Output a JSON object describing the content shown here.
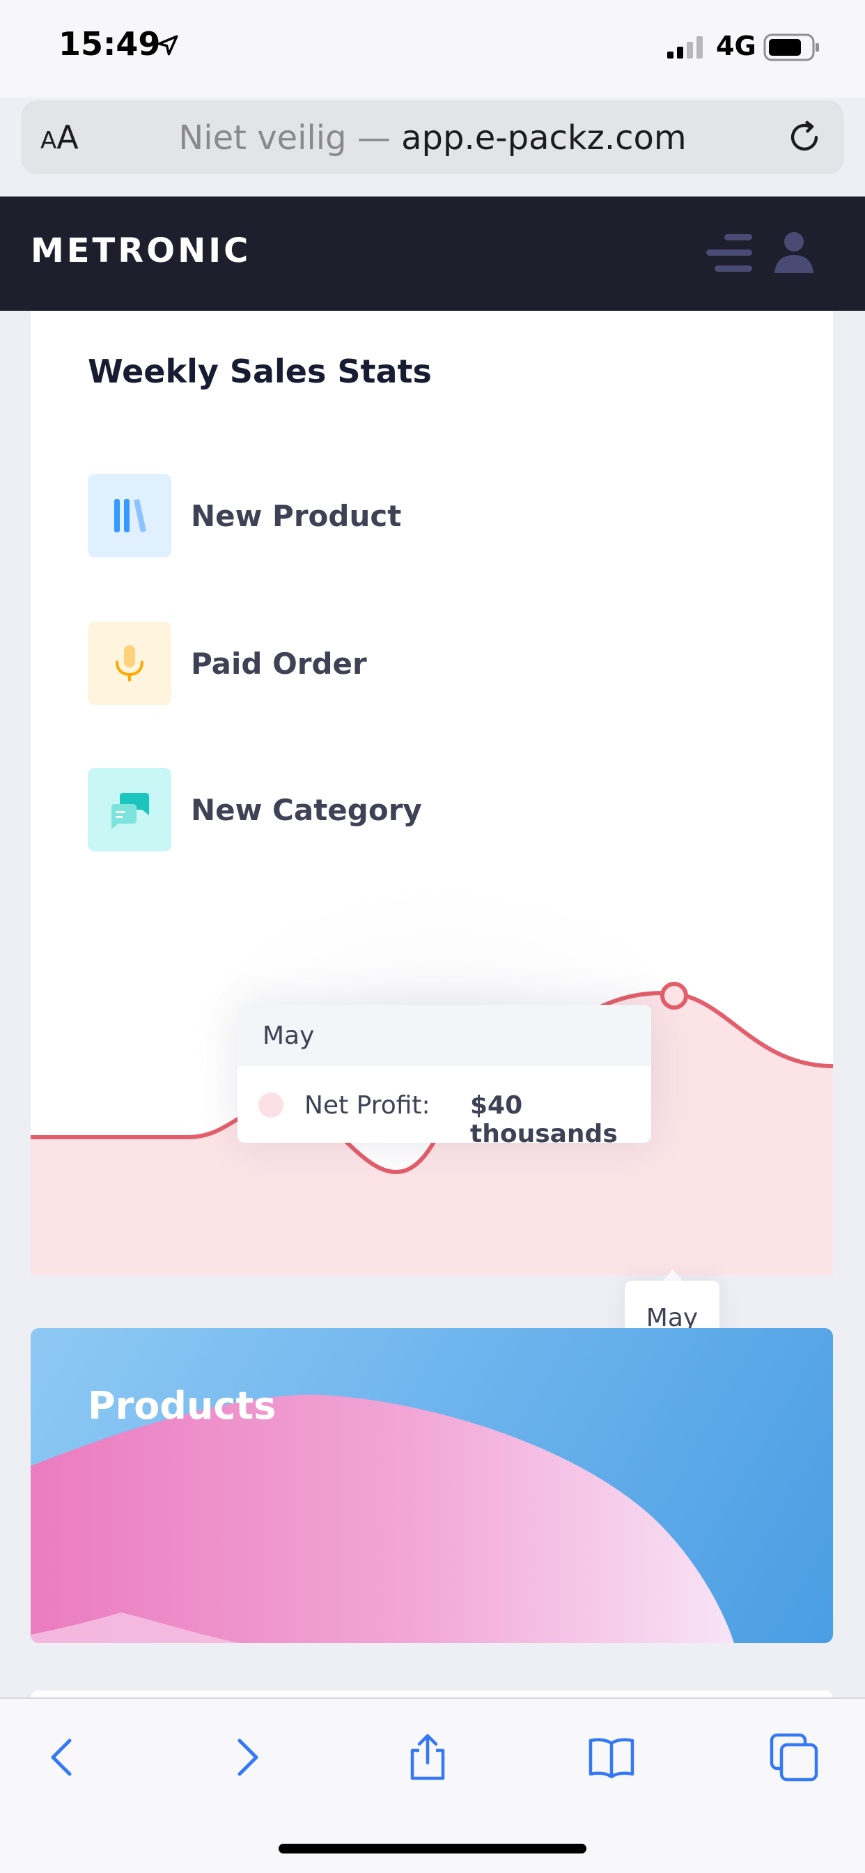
{
  "status_bar": {
    "time": "15:49",
    "network": "4G"
  },
  "browser": {
    "aa_small": "A",
    "aa_large": "A",
    "url_prefix": "Niet veilig —",
    "url_domain": "app.e-packz.com"
  },
  "header": {
    "brand": "METRONIC",
    "background": "#1e1e2d"
  },
  "card": {
    "title": "Weekly Sales Stats",
    "items": [
      {
        "label": "New Product",
        "icon": "library-icon",
        "bg": "#e1f0ff",
        "color": "#3699ff"
      },
      {
        "label": "Paid Order",
        "icon": "microphone-icon",
        "bg": "#fff4de",
        "color": "#ffa800"
      },
      {
        "label": "New Category",
        "icon": "chat-icon",
        "bg": "#c9f7f5",
        "color": "#1bc5bd"
      }
    ]
  },
  "chart_data": {
    "type": "area",
    "series_color": "#e35d6a",
    "fill_color": "#fbe3e6",
    "tooltip": {
      "category": "May",
      "series_label": "Net Profit:",
      "value_text": "$40 thousands"
    },
    "x_tooltip": "May"
  },
  "products": {
    "title": "Products"
  },
  "toolbar": {
    "items": [
      "back-icon",
      "forward-icon",
      "share-icon",
      "bookmarks-icon",
      "tabs-icon"
    ]
  }
}
